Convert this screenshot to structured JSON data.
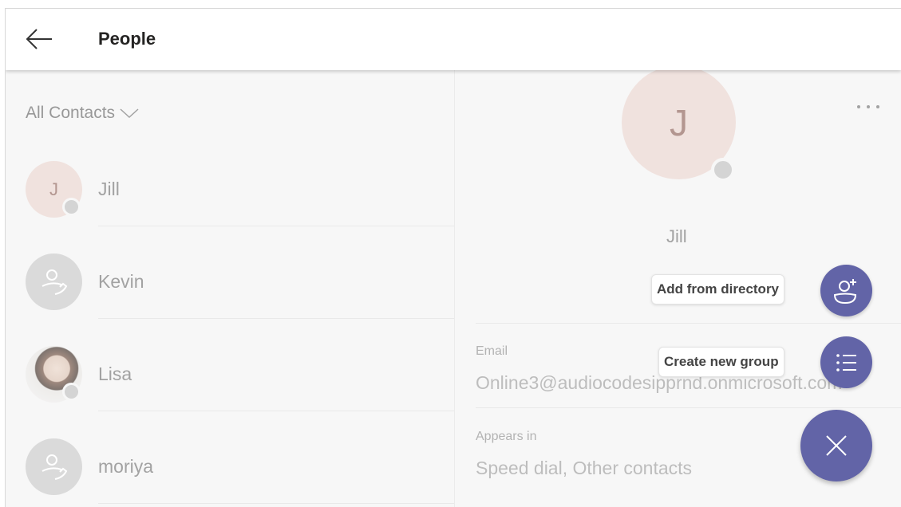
{
  "header": {
    "title": "People",
    "back_icon": "arrow-left-icon"
  },
  "contacts_list": {
    "filter_label": "All Contacts",
    "filter_icon": "chevron-down-icon",
    "items": [
      {
        "name": "Jill",
        "avatar_type": "initial",
        "initial": "J"
      },
      {
        "name": "Kevin",
        "avatar_type": "generic",
        "icon": "person-call-icon"
      },
      {
        "name": "Lisa",
        "avatar_type": "photo"
      },
      {
        "name": "moriya",
        "avatar_type": "generic",
        "icon": "person-call-icon"
      }
    ]
  },
  "detail": {
    "initial": "J",
    "name": "Jill",
    "sub_text": "-",
    "more_icon": "more-options-icon",
    "email_label": "Email",
    "email_value": "Online3@audiocodesipprnd.onmicrosoft.com",
    "appears_label": "Appears in",
    "appears_value": "Speed dial, Other contacts"
  },
  "fab_menu": {
    "add_from_directory": "Add from directory",
    "create_new_group": "Create new group",
    "add_icon": "add-person-icon",
    "group_icon": "list-icon",
    "close_icon": "close-icon"
  },
  "colors": {
    "accent": "#6264a7",
    "initial_avatar_bg": "#e9d3cd",
    "presence_offline": "#bdbdbd"
  }
}
